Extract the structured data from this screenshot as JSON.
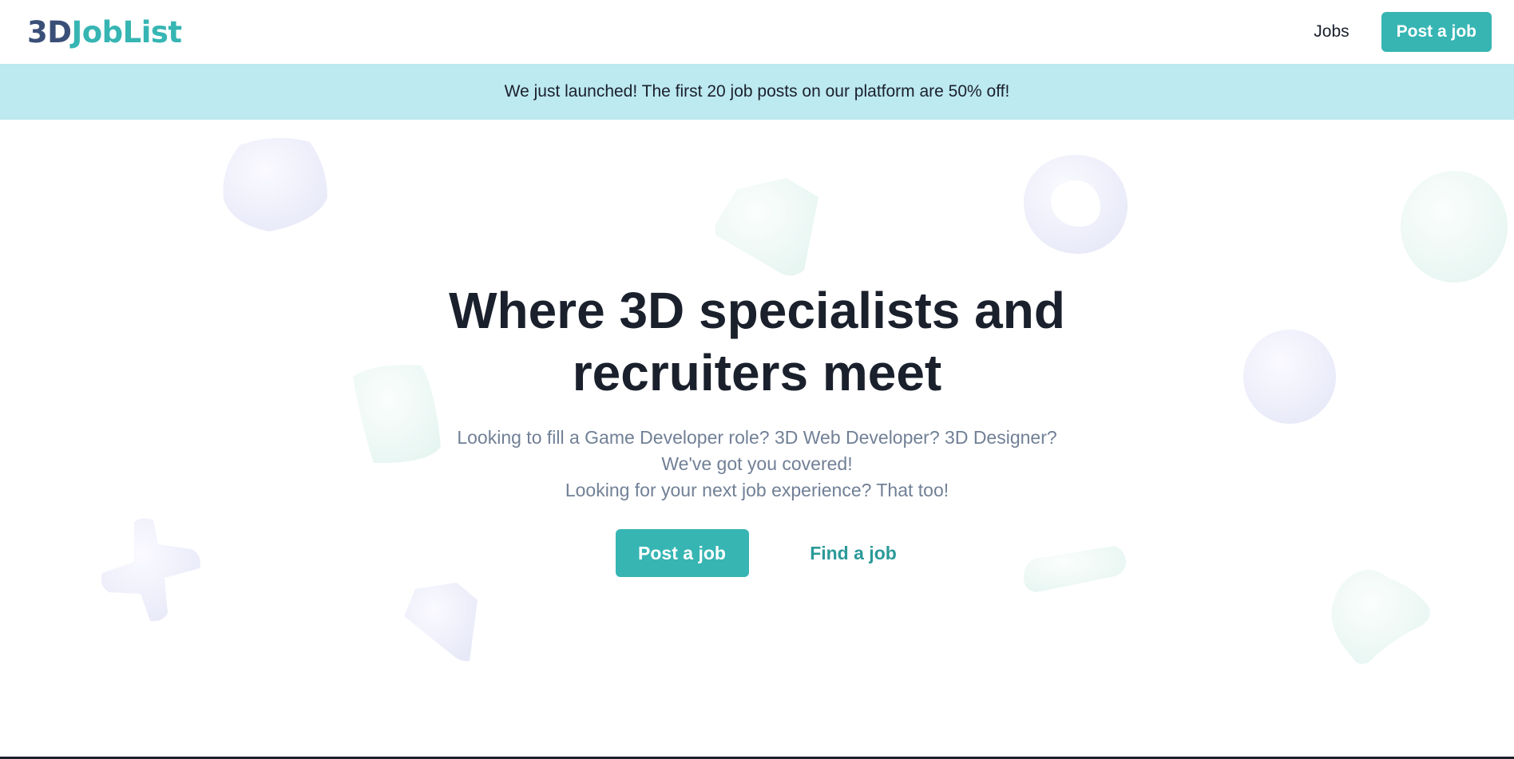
{
  "navbar": {
    "logo_part1": "3D",
    "logo_part2": "JobList",
    "jobs_link": "Jobs",
    "post_job_button": "Post a job"
  },
  "banner": {
    "text": "We just launched! The first 20 job posts on our platform are 50% off!"
  },
  "hero": {
    "title": "Where 3D specialists and recruiters meet",
    "subtitle_lines": [
      "Looking to fill a Game Developer role? 3D Web Developer? 3D Designer?",
      "We've got you covered!",
      "Looking for your next job experience? That too!"
    ],
    "primary_button": "Post a job",
    "secondary_button": "Find a job"
  },
  "colors": {
    "brand_teal": "#36b5b3",
    "logo_navy": "#3a4f78",
    "banner_bg": "#bde9f0",
    "heading": "#1a202c",
    "subtitle": "#718096"
  },
  "icons": [
    "cube-shape",
    "diamond-shape",
    "torus-shape",
    "sphere-shape",
    "cylinder-shape",
    "cross-shape",
    "gem-shape",
    "capsule-shape",
    "heart-shape"
  ]
}
